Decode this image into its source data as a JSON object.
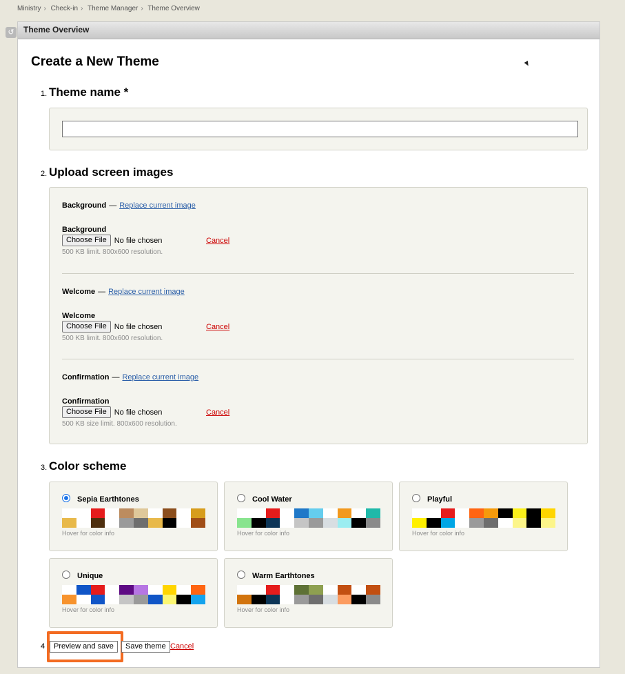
{
  "breadcrumb": [
    "Ministry",
    "Check-in",
    "Theme Manager",
    "Theme Overview"
  ],
  "panel_title": "Theme Overview",
  "page_title": "Create a New Theme",
  "steps": {
    "name": {
      "num": "1.",
      "title": "Theme name *",
      "value": ""
    },
    "images": {
      "num": "2.",
      "title": "Upload screen images",
      "sections": [
        {
          "heading": "Background",
          "replace_link": "Replace current image",
          "label": "Background",
          "button": "Choose File",
          "status": "No file chosen",
          "cancel": "Cancel",
          "hint": "500 KB limit. 800x600 resolution."
        },
        {
          "heading": "Welcome",
          "replace_link": "Replace current image",
          "label": "Welcome",
          "button": "Choose File",
          "status": "No file chosen",
          "cancel": "Cancel",
          "hint": "500 KB limit. 800x600 resolution."
        },
        {
          "heading": "Confirmation",
          "replace_link": "Replace current image",
          "label": "Confirmation",
          "button": "Choose File",
          "status": "No file chosen",
          "cancel": "Cancel",
          "hint": "500 KB size limit. 800x600 resolution."
        }
      ]
    },
    "colors": {
      "num": "3.",
      "title": "Color scheme",
      "hover_hint": "Hover for color info",
      "schemes": [
        {
          "name": "Sepia Earthtones",
          "selected": true,
          "top": [
            "#ffffff",
            "#ffffff",
            "#e51c1c",
            "#ffffff",
            "#bc8c5f",
            "#dfc89a",
            "#ffffff",
            "#8b4e1d",
            "#ffffff",
            "#d79d1d"
          ],
          "bottom": [
            "#e8b94a",
            "#ffffff",
            "#4e2f0e",
            "#ffffff",
            "#9a9a9a",
            "#6e6e6e",
            "#e8b94a",
            "#000000",
            "#ffffff",
            "#a04e17"
          ]
        },
        {
          "name": "Cool Water",
          "selected": false,
          "top": [
            "#ffffff",
            "#ffffff",
            "#e51c1c",
            "#ffffff",
            "#1f78c8",
            "#65cdee",
            "#ffffff",
            "#f2991e",
            "#ffffff",
            "#1fb9a9"
          ],
          "bottom": [
            "#88e48e",
            "#000000",
            "#0d3556",
            "#ffffff",
            "#c5c5c5",
            "#9a9a9a",
            "#d8dee2",
            "#9bedf1",
            "#000000",
            "#8a8a8a"
          ]
        },
        {
          "name": "Playful",
          "selected": false,
          "top": [
            "#ffffff",
            "#ffffff",
            "#e51c1c",
            "#ffffff",
            "#ff6512",
            "#f59a0c",
            "#000000",
            "#fbf01a",
            "#000000",
            "#ffd500"
          ],
          "bottom": [
            "#fff000",
            "#000000",
            "#00a6e5",
            "#ffffff",
            "#9a9a9a",
            "#6e6e6e",
            "#ffffff",
            "#fcf58a",
            "#000000",
            "#fcf58a"
          ]
        },
        {
          "name": "Unique",
          "selected": false,
          "top": [
            "#ffffff",
            "#1055c7",
            "#e51c1c",
            "#ffffff",
            "#5e0a84",
            "#b676e3",
            "#ffffff",
            "#ffd500",
            "#ffffff",
            "#ff6512"
          ],
          "bottom": [
            "#f7932d",
            "#ffffff",
            "#1055c7",
            "#ffffff",
            "#c5c5c5",
            "#9a9a9a",
            "#1055c7",
            "#fbf672",
            "#000000",
            "#14a3ed"
          ]
        },
        {
          "name": "Warm Earthtones",
          "selected": false,
          "top": [
            "#ffffff",
            "#ffffff",
            "#e51c1c",
            "#ffffff",
            "#5e7135",
            "#8ea050",
            "#ffffff",
            "#c24f11",
            "#ffffff",
            "#c24f11"
          ],
          "bottom": [
            "#d2740e",
            "#000000",
            "#0d3556",
            "#ffffff",
            "#9a9a9a",
            "#6e6e6e",
            "#d8dee2",
            "#fc9b5f",
            "#000000",
            "#8a8a8a"
          ]
        }
      ]
    },
    "actions": {
      "num": "4",
      "preview_label": "Preview and save",
      "save_label": "Save theme",
      "cancel_label": "Cancel"
    }
  },
  "colors": {
    "accent": "#f36b21",
    "link": "#2a5ea8",
    "cancel": "#cc0000"
  }
}
